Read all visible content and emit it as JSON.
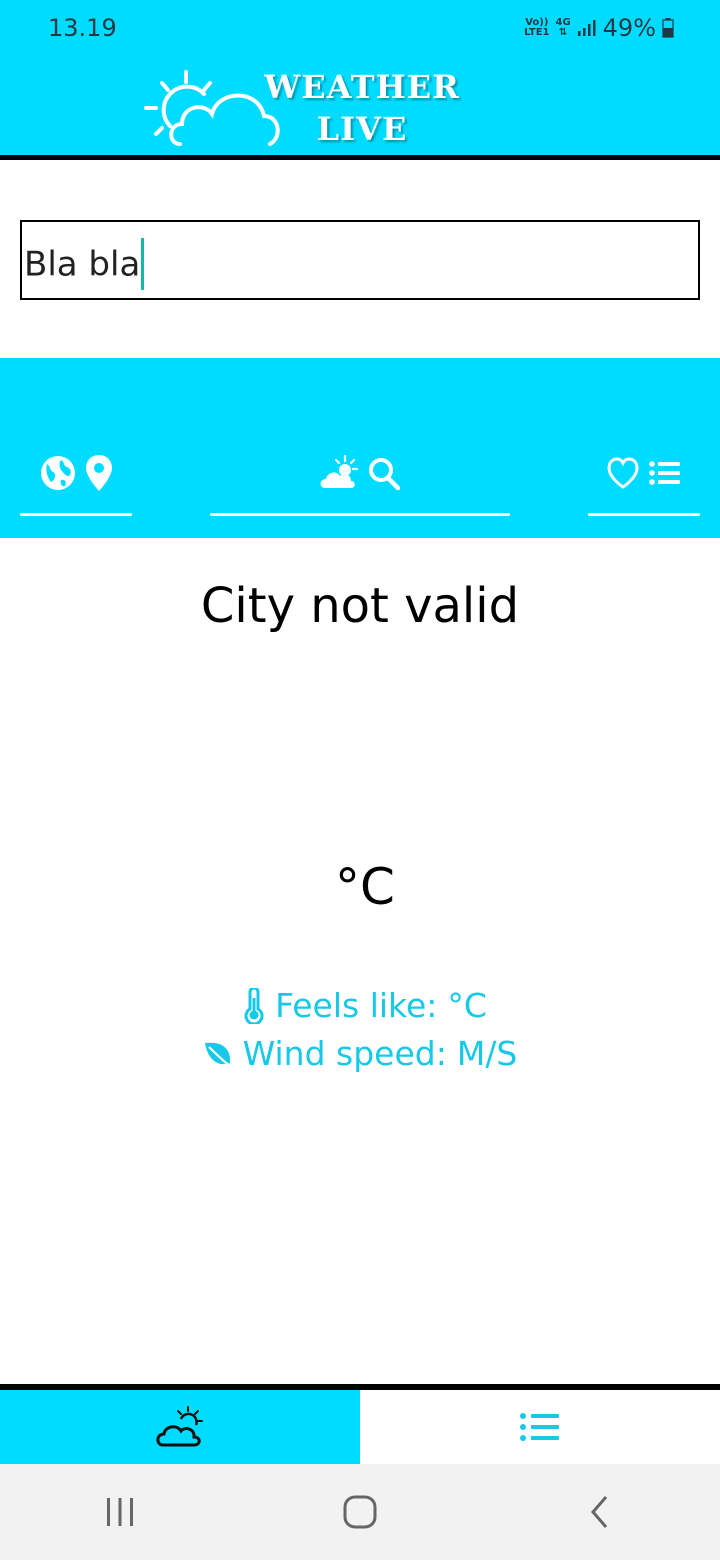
{
  "status_bar": {
    "time": "13.19",
    "network_top": "Vo))",
    "network_bottom": "LTE1",
    "data_type": "4G",
    "battery": "49%"
  },
  "header": {
    "title_line1": "WEATHER",
    "title_line2": "LIVE",
    "icon": "sun-cloud-logo-icon",
    "accent": "#00dcff"
  },
  "search": {
    "value": "Bla bla",
    "caret_color": "#14b8a6"
  },
  "tabs": [
    {
      "icons": [
        "globe-icon",
        "location-pin-icon"
      ]
    },
    {
      "icons": [
        "weather-cloud-sun-icon",
        "search-icon"
      ]
    },
    {
      "icons": [
        "heart-icon",
        "list-icon"
      ]
    }
  ],
  "main": {
    "city": "City not valid",
    "temperature": "°C",
    "feels_like_label": "Feels like:",
    "feels_like_value": "°C",
    "wind_label": "Wind speed:",
    "wind_value": "M/S",
    "info_color": "#17c9e8"
  },
  "bottom_nav": {
    "items": [
      {
        "icon": "weather-cloud-sun-icon",
        "active": true
      },
      {
        "icon": "list-icon",
        "active": false
      }
    ]
  },
  "system_nav": [
    "recent-apps-icon",
    "home-icon",
    "back-icon"
  ]
}
